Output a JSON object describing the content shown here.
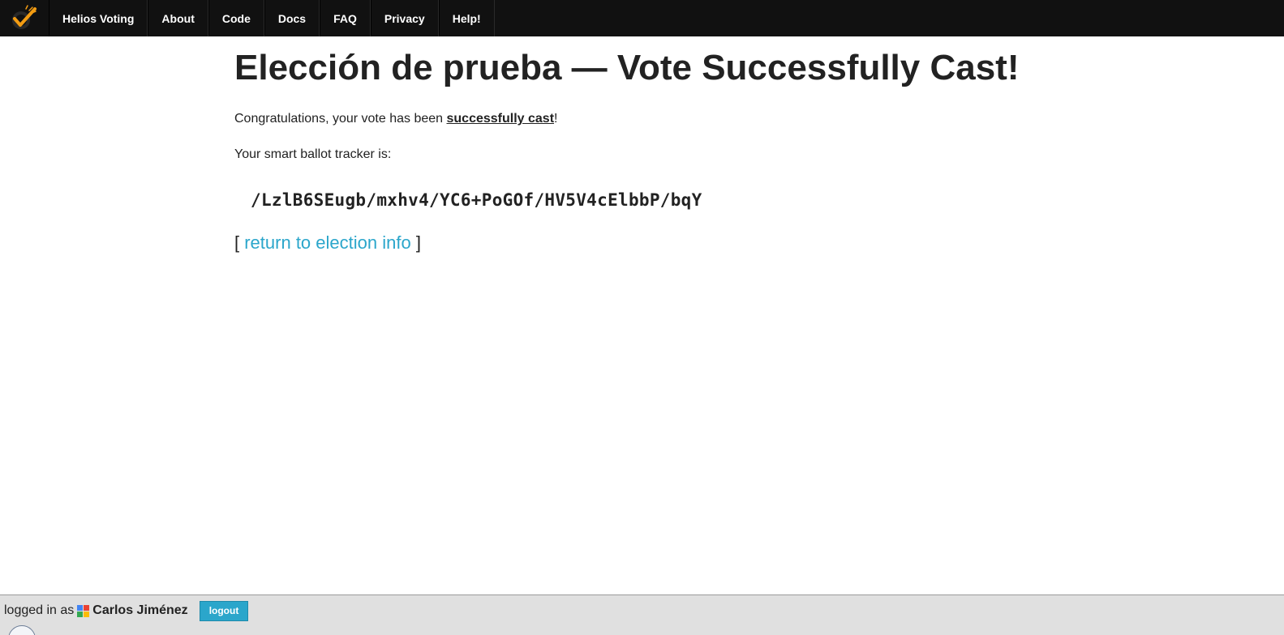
{
  "nav": {
    "logo_icon": "helios-checkmark-logo",
    "items": [
      {
        "label": "Helios Voting"
      },
      {
        "label": "About"
      },
      {
        "label": "Code"
      },
      {
        "label": "Docs"
      },
      {
        "label": "FAQ"
      },
      {
        "label": "Privacy"
      },
      {
        "label": "Help!"
      }
    ]
  },
  "main": {
    "title": "Elección de prueba — Vote Successfully Cast!",
    "congrats_prefix": "Congratulations, your vote has been ",
    "congrats_strong": "successfully cast",
    "congrats_suffix": "!",
    "tracker_label": "Your smart ballot tracker is:",
    "tracker_value": "/LzlB6SEugb/mxhv4/YC6+PoGOf/HV5V4cElbbP/bqY",
    "return_open": "[ ",
    "return_link": "return to election info",
    "return_close": " ]"
  },
  "footer": {
    "logged_in_as": "logged in as",
    "provider_icon": "google-icon",
    "user_name": "Carlos Jiménez",
    "logout_label": "logout"
  },
  "colors": {
    "nav_background": "#111111",
    "link": "#2ba6cb",
    "logout_button": "#2ba6cb",
    "footer_background": "#e0e0e0",
    "logo_orange": "#f39c12"
  }
}
